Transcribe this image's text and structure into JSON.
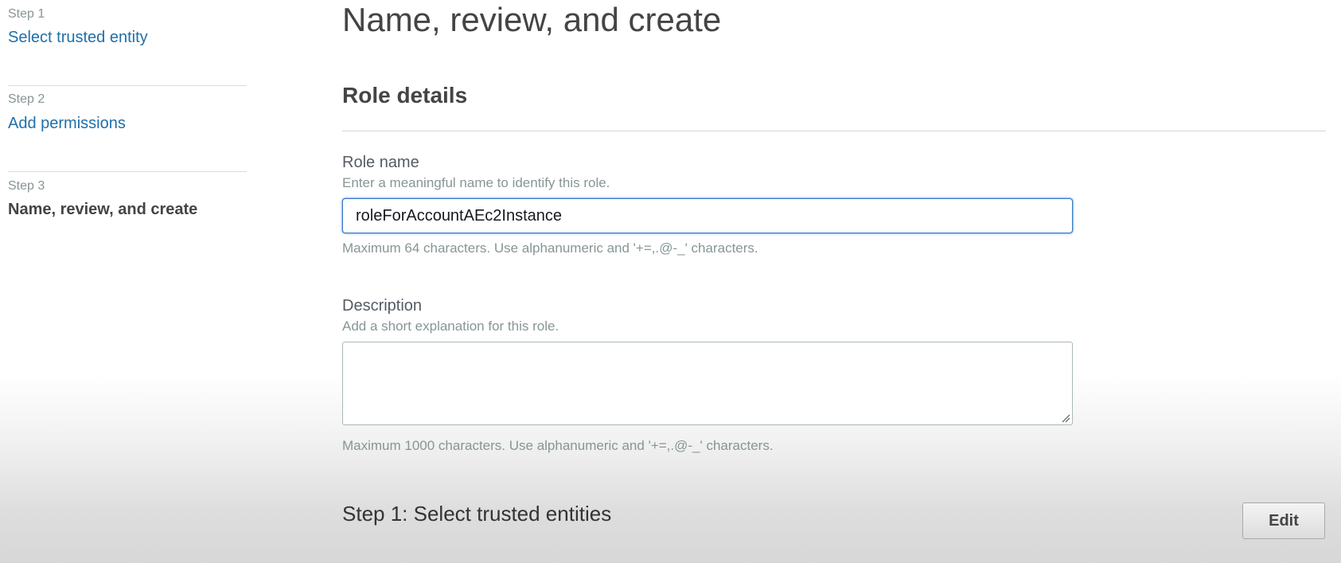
{
  "nav": {
    "steps": [
      {
        "number": "Step 1",
        "title": "Select trusted entity",
        "state": "link"
      },
      {
        "number": "Step 2",
        "title": "Add permissions",
        "state": "link"
      },
      {
        "number": "Step 3",
        "title": "Name, review, and create",
        "state": "current"
      }
    ]
  },
  "main": {
    "title": "Name, review, and create",
    "role_details": {
      "heading": "Role details",
      "role_name": {
        "label": "Role name",
        "hint": "Enter a meaningful name to identify this role.",
        "value": "roleForAccountAEc2Instance",
        "constraint": "Maximum 64 characters. Use alphanumeric and '+=,.@-_' characters."
      },
      "description": {
        "label": "Description",
        "hint": "Add a short explanation for this role.",
        "value": "",
        "constraint": "Maximum 1000 characters. Use alphanumeric and '+=,.@-_' characters."
      }
    },
    "trusted_entities": {
      "heading": "Step 1: Select trusted entities",
      "edit_label": "Edit"
    }
  },
  "colors": {
    "link": "#1f6fa9",
    "focus_border": "#3b7fc4",
    "muted_text": "#879596"
  }
}
